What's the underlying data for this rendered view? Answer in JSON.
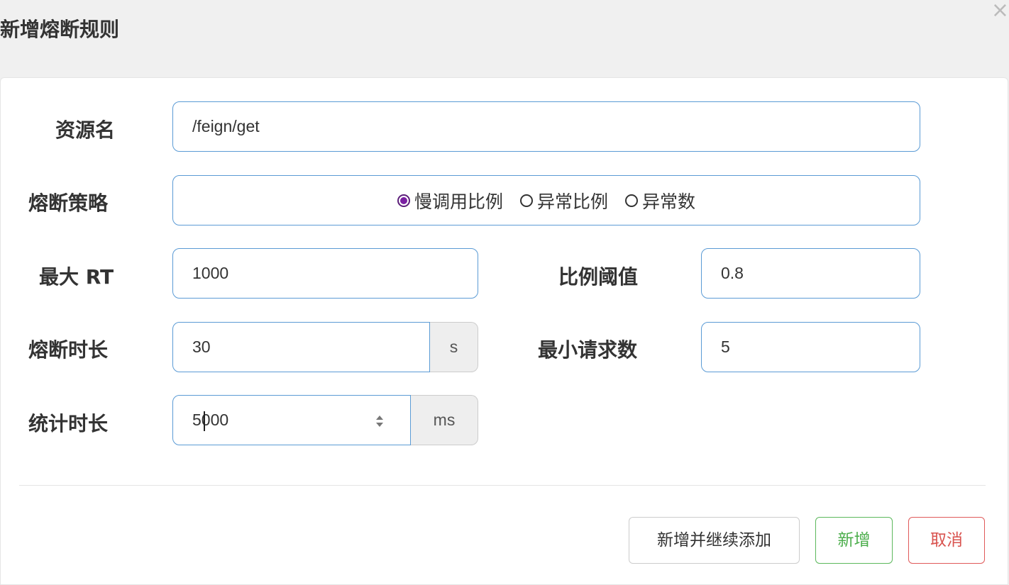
{
  "dialog": {
    "title": "新增熔断规则",
    "close_icon": "×"
  },
  "form": {
    "resource": {
      "label": "资源名",
      "value": "/feign/get"
    },
    "strategy": {
      "label": "熔断策略",
      "options": [
        {
          "label": "慢调用比例",
          "checked": true
        },
        {
          "label": "异常比例",
          "checked": false
        },
        {
          "label": "异常数",
          "checked": false
        }
      ]
    },
    "max_rt": {
      "label": "最大 RT",
      "value": "1000"
    },
    "ratio_threshold": {
      "label": "比例阈值",
      "value": "0.8"
    },
    "break_duration": {
      "label": "熔断时长",
      "value": "30",
      "unit": "s"
    },
    "min_requests": {
      "label": "最小请求数",
      "value": "5"
    },
    "stat_duration": {
      "label": "统计时长",
      "value": "5000",
      "unit": "ms"
    }
  },
  "buttons": {
    "add_continue": "新增并继续添加",
    "add": "新增",
    "cancel": "取消"
  },
  "colors": {
    "input_border": "#5b9bd5",
    "radio_checked": "#7a1fa2",
    "success": "#4cae4c",
    "danger": "#d9534f"
  }
}
